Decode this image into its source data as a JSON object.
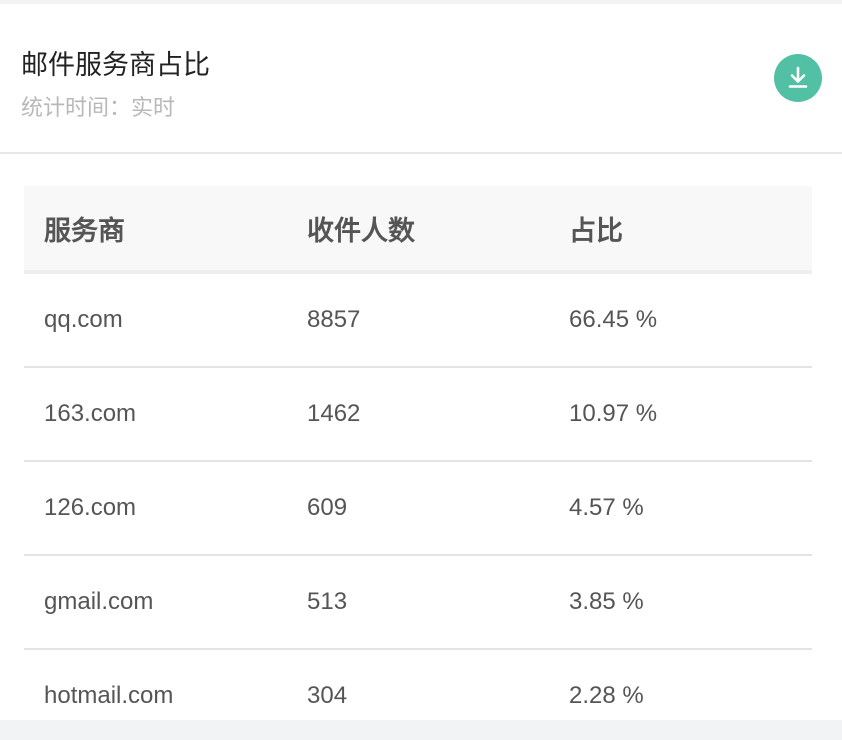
{
  "header": {
    "title": "邮件服务商占比",
    "subtitle": "统计时间：实时",
    "download_icon": "download-icon"
  },
  "table": {
    "columns": [
      "服务商",
      "收件人数",
      "占比"
    ],
    "rows": [
      [
        "qq.com",
        "8857",
        "66.45 %"
      ],
      [
        "163.com",
        "1462",
        "10.97 %"
      ],
      [
        "126.com",
        "609",
        "4.57 %"
      ],
      [
        "gmail.com",
        "513",
        "3.85 %"
      ],
      [
        "hotmail.com",
        "304",
        "2.28 %"
      ]
    ]
  },
  "colors": {
    "accent": "#52c0a5",
    "background": "#f2f3f5"
  }
}
